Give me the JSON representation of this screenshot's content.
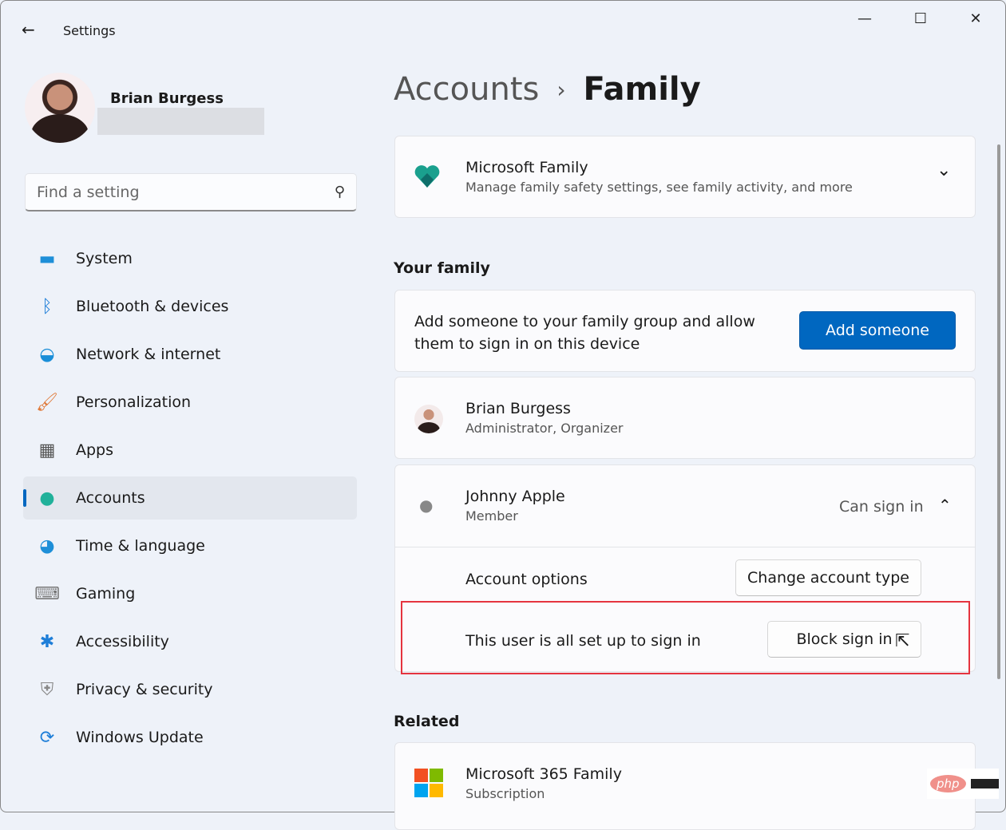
{
  "titlebar": {
    "title": "Settings",
    "back_icon": "arrow-left-icon",
    "minimize": "—",
    "maximize": "☐",
    "close": "✕"
  },
  "user": {
    "name": "Brian Burgess"
  },
  "search": {
    "placeholder": "Find a setting"
  },
  "sidebar": {
    "items": [
      {
        "label": "System",
        "icon": "monitor-icon",
        "glyph": "▬",
        "color": "#1e8fd8"
      },
      {
        "label": "Bluetooth & devices",
        "icon": "bluetooth-icon",
        "glyph": "ᛒ",
        "color": "#1e7ed8"
      },
      {
        "label": "Network & internet",
        "icon": "wifi-icon",
        "glyph": "◒",
        "color": "#1a8ed8"
      },
      {
        "label": "Personalization",
        "icon": "brush-icon",
        "glyph": "🖌",
        "color": "#e07a3a"
      },
      {
        "label": "Apps",
        "icon": "apps-icon",
        "glyph": "▦",
        "color": "#555"
      },
      {
        "label": "Accounts",
        "icon": "person-icon",
        "glyph": "●",
        "color": "#21b19a",
        "selected": true
      },
      {
        "label": "Time & language",
        "icon": "globe-clock-icon",
        "glyph": "◕",
        "color": "#1e8fd8"
      },
      {
        "label": "Gaming",
        "icon": "gamepad-icon",
        "glyph": "⌨",
        "color": "#777"
      },
      {
        "label": "Accessibility",
        "icon": "accessibility-icon",
        "glyph": "✱",
        "color": "#1e7ed8"
      },
      {
        "label": "Privacy & security",
        "icon": "shield-icon",
        "glyph": "⛨",
        "color": "#888"
      },
      {
        "label": "Windows Update",
        "icon": "update-icon",
        "glyph": "⟳",
        "color": "#1e7ed8"
      }
    ]
  },
  "breadcrumb": {
    "parent": "Accounts",
    "separator": "›",
    "current": "Family"
  },
  "ms_family": {
    "title": "Microsoft Family",
    "subtitle": "Manage family safety settings, see family activity, and more",
    "chevron": "⌄"
  },
  "your_family": {
    "heading": "Your family",
    "add_text": "Add someone to your family group and allow them to sign in on this device",
    "add_button": "Add someone",
    "accent": "#0067c0"
  },
  "members": [
    {
      "name": "Brian Burgess",
      "role": "Administrator, Organizer"
    },
    {
      "name": "Johnny Apple",
      "role": "Member",
      "status": "Can sign in",
      "expanded": true,
      "options_label": "Account options",
      "change_button": "Change account type",
      "signin_text": "This user is all set up to sign in",
      "block_button": "Block sign in"
    }
  ],
  "related": {
    "heading": "Related",
    "items": [
      {
        "title": "Microsoft 365 Family",
        "subtitle": "Subscription"
      }
    ]
  },
  "watermark": {
    "logo": "php"
  }
}
